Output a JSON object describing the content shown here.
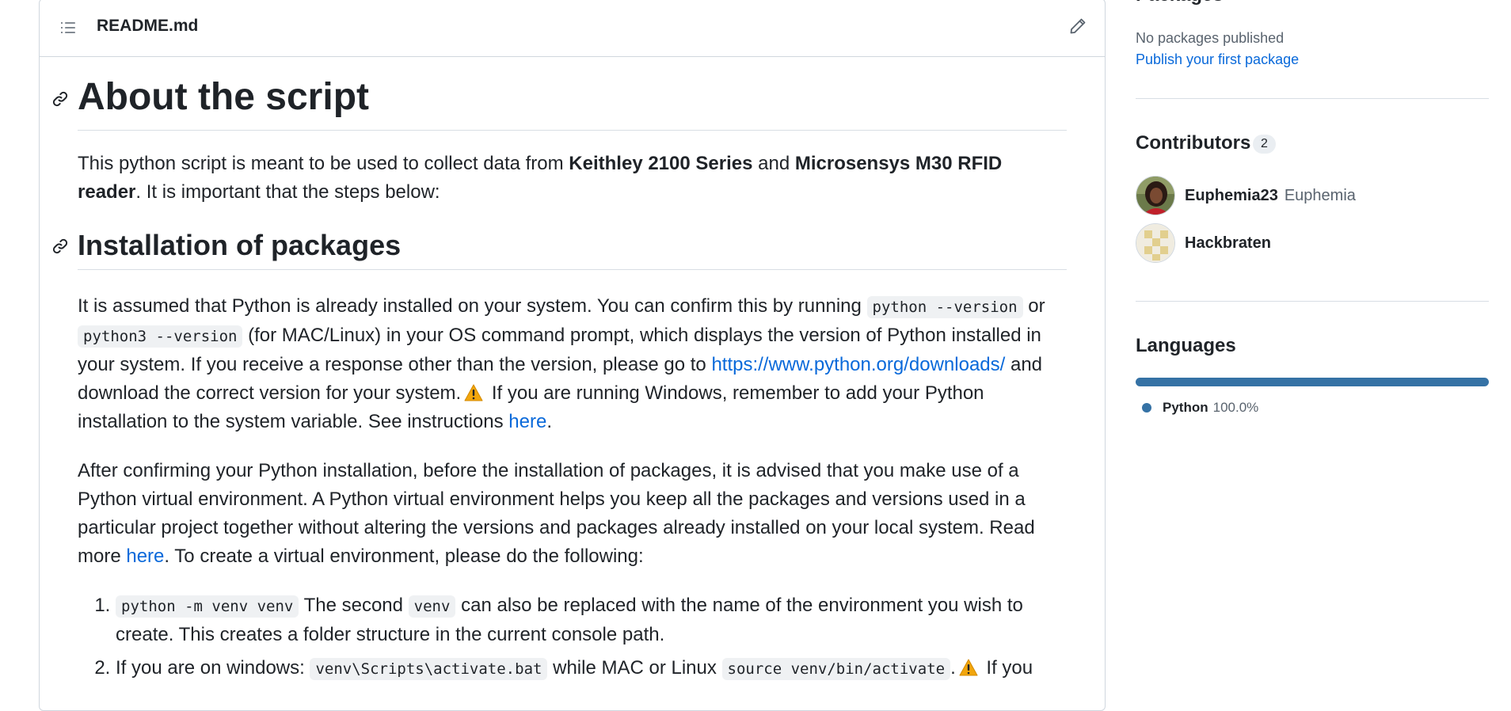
{
  "readme": {
    "filename": "README.md",
    "h1": "About the script",
    "p1": {
      "t1": "This python script is meant to be used to collect data from ",
      "b1": "Keithley 2100 Series",
      "t2": " and ",
      "b2": "Microsensys M30 RFID reader",
      "t3": ". It is important that the steps below:"
    },
    "h2": "Installation of packages",
    "p2": {
      "t1": "It is assumed that Python is already installed on your system. You can confirm this by running ",
      "c1": "python --version",
      "t2": " or ",
      "c2": "python3 --version",
      "t3": " (for MAC/Linux) in your OS command prompt, which displays the version of Python installed in your system. If you receive a response other than the version, please go to ",
      "link1": "https://www.python.org/downloads/",
      "t4": " and download the correct version for your system.",
      "t5": " If you are running Windows, remember to add your Python installation to the system variable. See instructions ",
      "link2": "here",
      "t6": "."
    },
    "p3": {
      "t1": "After confirming your Python installation, before the installation of packages, it is advised that you make use of a Python virtual environment. A Python virtual environment helps you keep all the packages and versions used in a particular project together without altering the versions and packages already installed on your local system. Read more ",
      "link": "here",
      "t2": ". To create a virtual environment, please do the following:"
    },
    "steps": [
      {
        "c1": "python -m venv venv",
        "t1": " The second ",
        "c2": "venv",
        "t2": " can also be replaced with the name of the environment you wish to create. This creates a folder structure in the current console path."
      },
      {
        "t1": "If you are on windows: ",
        "c1": "venv\\Scripts\\activate.bat",
        "t2": " while MAC or Linux ",
        "c2": "source venv/bin/activate",
        "t3": ".",
        "t4": " If you"
      }
    ]
  },
  "sidebar": {
    "packages": {
      "title": "Packages",
      "none": "No packages published",
      "link": "Publish your first package"
    },
    "contributors": {
      "title": "Contributors",
      "count": "2",
      "list": [
        {
          "login": "Euphemia23",
          "name": "Euphemia"
        },
        {
          "login": "Hackbraten",
          "name": ""
        }
      ]
    },
    "languages": {
      "title": "Languages",
      "items": [
        {
          "name": "Python",
          "percent": "100.0%",
          "color": "#3572a5"
        }
      ]
    }
  },
  "colors": {
    "link": "#0969da",
    "python": "#3572a5",
    "border": "#d0d7de",
    "warning": "#f2a60d"
  }
}
